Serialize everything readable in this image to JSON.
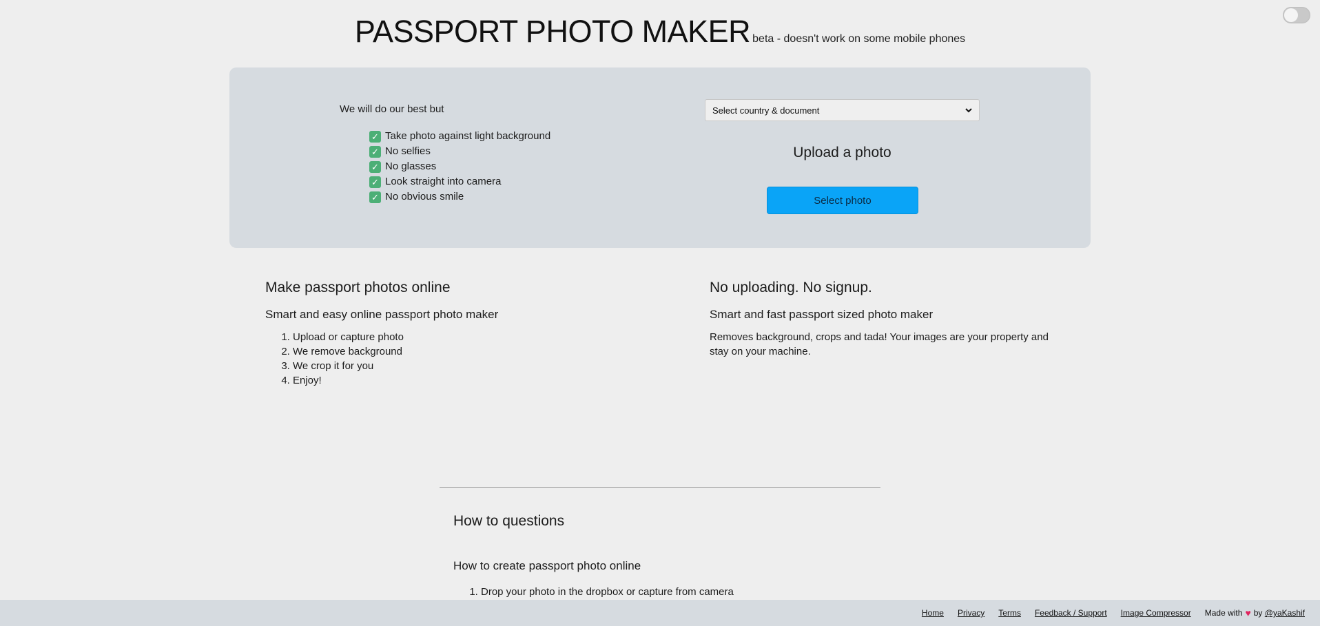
{
  "header": {
    "title": "PASSPORT PHOTO MAKER",
    "tagline": "beta - doesn't work on some mobile phones"
  },
  "hero": {
    "intro": "We will do our best but",
    "tips": [
      "Take photo against light background",
      "No selfies",
      "No glasses",
      "Look straight into camera",
      "No obvious smile"
    ],
    "select_placeholder": "Select country & document",
    "upload_title": "Upload a photo",
    "select_photo_label": "Select photo"
  },
  "left_info": {
    "heading": "Make passport photos online",
    "subheading": "Smart and easy online passport photo maker",
    "steps": [
      "Upload or capture photo",
      "We remove background",
      "We crop it for you",
      "Enjoy!"
    ]
  },
  "right_info": {
    "heading": "No uploading. No signup.",
    "subheading": "Smart and fast passport sized photo maker",
    "text": "Removes background, crops and tada! Your images are your property and stay on your machine."
  },
  "faq": {
    "title": "How to questions",
    "question": "How to create passport photo online",
    "steps": [
      "Drop your photo in the dropbox or capture from camera"
    ]
  },
  "footer": {
    "links": [
      "Home",
      "Privacy",
      "Terms",
      "Feedback / Support",
      "Image Compressor"
    ],
    "made_with": "Made with",
    "by": "by",
    "author": "@yaKashif"
  },
  "colors": {
    "accent": "#0aa4f7",
    "panel": "#d6dbe0",
    "check": "#4caf76",
    "heart": "#e0245e"
  }
}
